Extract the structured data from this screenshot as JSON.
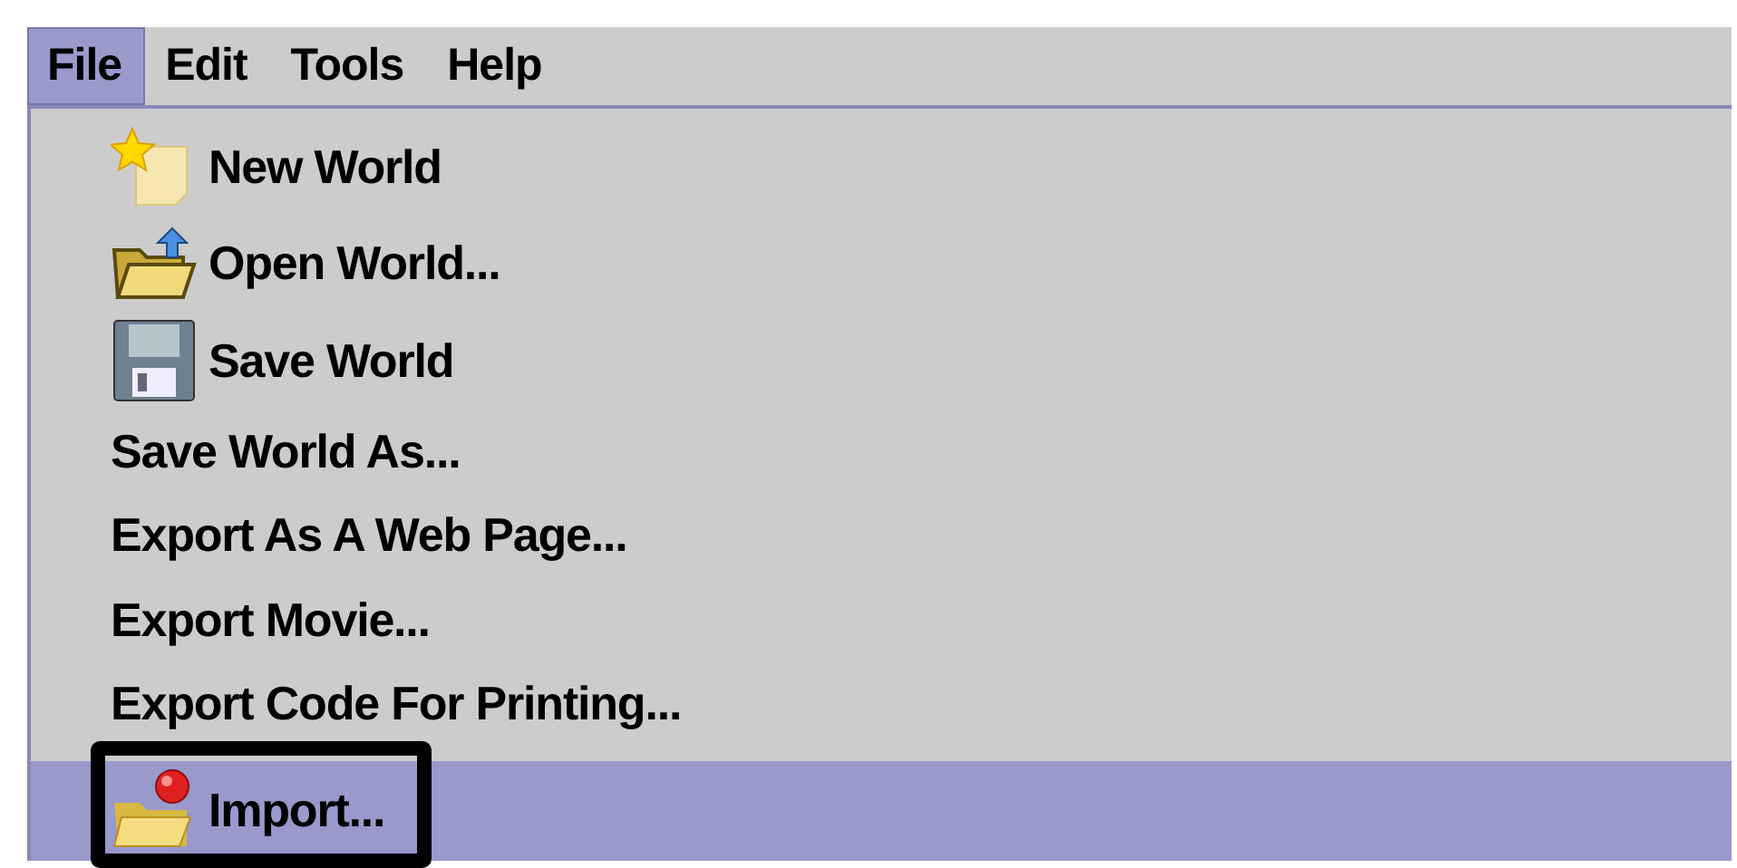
{
  "menubar": [
    {
      "label": "File",
      "selected": true
    },
    {
      "label": "Edit",
      "selected": false
    },
    {
      "label": "Tools",
      "selected": false
    },
    {
      "label": "Help",
      "selected": false
    }
  ],
  "menu": {
    "items": [
      {
        "kind": "star-page",
        "label": "New World",
        "selected": false,
        "outlined": false
      },
      {
        "kind": "folder-arrow",
        "label": "Open World...",
        "selected": false,
        "outlined": false
      },
      {
        "kind": "floppy",
        "label": "Save World",
        "selected": false,
        "outlined": false
      },
      {
        "kind": "text",
        "label": "Save World As...",
        "selected": false,
        "outlined": false
      },
      {
        "kind": "text",
        "label": "Export As A Web Page...",
        "selected": false,
        "outlined": false
      },
      {
        "kind": "text",
        "label": "Export Movie...",
        "selected": false,
        "outlined": false
      },
      {
        "kind": "text",
        "label": "Export Code For Printing...",
        "selected": false,
        "outlined": false
      },
      {
        "kind": "folder-dot",
        "label": "Import...",
        "selected": true,
        "outlined": true
      }
    ]
  }
}
